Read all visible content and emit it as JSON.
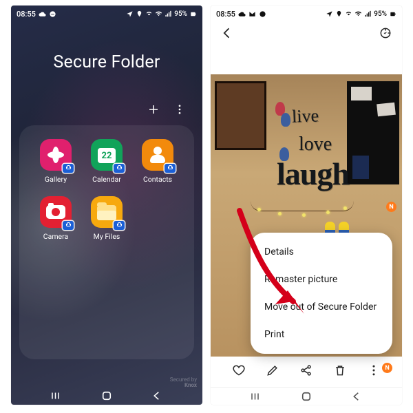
{
  "status": {
    "time": "08:55",
    "left_icons": [
      "cloud-icon",
      "dnd-icon",
      "mail-icon"
    ],
    "right_icons": [
      "nav-icon",
      "pin-icon",
      "vowifi-icon",
      "wifi-icon",
      "signal-icon"
    ],
    "battery_text": "95%"
  },
  "secure_folder": {
    "title": "Secure Folder",
    "actions": {
      "add": "+",
      "more": "⋮"
    },
    "apps": [
      {
        "name": "gallery",
        "label": "Gallery"
      },
      {
        "name": "calendar",
        "label": "Calendar",
        "day": "22"
      },
      {
        "name": "contacts",
        "label": "Contacts"
      },
      {
        "name": "camera",
        "label": "Camera"
      },
      {
        "name": "files",
        "label": "My Files"
      }
    ],
    "knox_line1": "Secured by",
    "knox_line2": "Knox"
  },
  "gallery": {
    "wall_words": {
      "live": "live",
      "love": "love",
      "laugh": "laugh"
    },
    "menu": [
      "Details",
      "Remaster picture",
      "Move out of Secure Folder",
      "Print"
    ],
    "new_badge": "N",
    "actions": [
      "favorite",
      "edit",
      "share",
      "delete",
      "more"
    ]
  },
  "nav": [
    "recent",
    "home",
    "back"
  ]
}
